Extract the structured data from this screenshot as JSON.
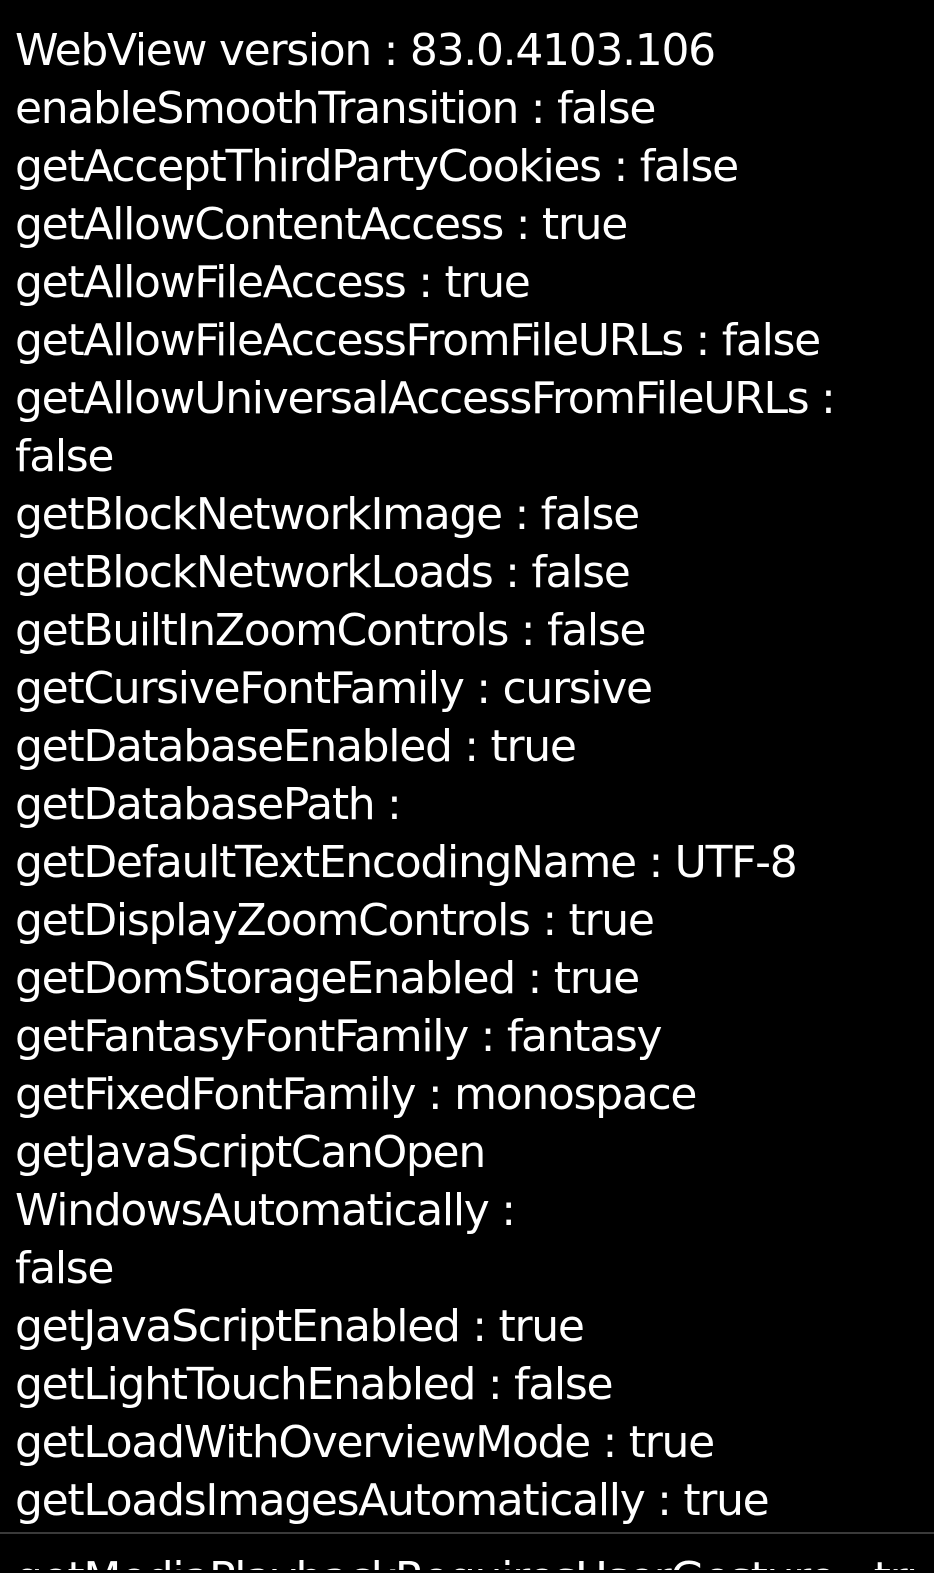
{
  "screen": {
    "background": "#000000",
    "text_color": "#ffffff"
  },
  "lines": [
    "WebView version : 83.0.4103.106",
    "enableSmoothTransition : false",
    "getAcceptThirdPartyCookies : false",
    "getAllowContentAccess : true",
    "getAllowFileAccess : true",
    "getAllowFileAccessFromFileURLs : false",
    "getAllowUniversalAccessFromFileURLs :",
    "false",
    "getBlockNetworkImage : false",
    "getBlockNetworkLoads : false",
    "getBuiltInZoomControls : false",
    "getCursiveFontFamily : cursive",
    "getDatabaseEnabled : true",
    "getDatabasePath :",
    "getDefaultTextEncodingName : UTF-8",
    "getDisplayZoomControls : true",
    "getDomStorageEnabled : true",
    "getFantasyFontFamily : fantasy",
    "getFixedFontFamily : monospace",
    "getJavaScriptCanOpen",
    "WindowsAutomatically :",
    "false",
    "getJavaScriptEnabled : true",
    "getLightTouchEnabled : false",
    "getLoadWithOverviewMode : true",
    "getLoadsImagesAutomatically : true"
  ],
  "partial_line": "getMediaPlaybackRequiresUserGesture : true"
}
